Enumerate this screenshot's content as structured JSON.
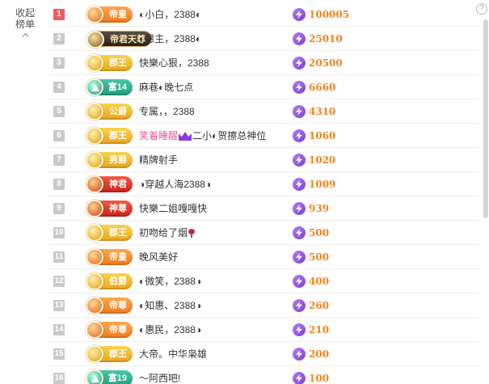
{
  "panel": {
    "collapse_label_1": "收起",
    "collapse_label_2": "榜单",
    "help_label": "?"
  },
  "rows": [
    {
      "rank": "1",
      "badge": "帝皇",
      "badge_style": "orange",
      "badge_emblem": "crown-emblem-icon",
      "name": "◐小白，2388◐",
      "score": "100005"
    },
    {
      "rank": "2",
      "badge": "帝君天尊",
      "badge_style": "dark",
      "badge_emblem": "armor-emblem-icon",
      "name": "◐惠主，2388◐",
      "score": "25010"
    },
    {
      "rank": "3",
      "badge": "郡王",
      "badge_style": "gold",
      "badge_emblem": "gold-emblem-icon",
      "name": "快樂心狠，2388",
      "score": "20500"
    },
    {
      "rank": "4",
      "badge": "富14",
      "badge_style": "teal",
      "badge_emblem": "triangle-emblem-icon",
      "name": "麻巷◐晚七点",
      "score": "6660"
    },
    {
      "rank": "5",
      "badge": "公爵",
      "badge_style": "gold",
      "badge_emblem": "gold-emblem-icon",
      "name": "专属，，2388",
      "score": "4310"
    },
    {
      "rank": "6",
      "badge": "郡王",
      "badge_style": "gold",
      "badge_emblem": "gold-emblem-icon",
      "name": "笑着睡醒",
      "name_suffix": "二小◐贺擦总神位",
      "score": "1060"
    },
    {
      "rank": "7",
      "badge": "男爵",
      "badge_style": "gold",
      "badge_emblem": "gold-emblem-icon",
      "name": "精牌射手",
      "score": "1020"
    },
    {
      "rank": "8",
      "badge": "神君",
      "badge_style": "red",
      "badge_emblem": "red-emblem-icon",
      "name": "◑穿越人海2388◑",
      "score": "1009"
    },
    {
      "rank": "9",
      "badge": "神尊",
      "badge_style": "red",
      "badge_emblem": "red-emblem-icon",
      "name": "快樂二姐嘎嘎快",
      "score": "939"
    },
    {
      "rank": "10",
      "badge": "郡王",
      "badge_style": "gold",
      "badge_emblem": "gold-emblem-icon",
      "name": "初吻给了烟",
      "score": "500"
    },
    {
      "rank": "11",
      "badge": "帝皇",
      "badge_style": "orange",
      "badge_emblem": "crown-emblem-icon",
      "name": "晚风美好",
      "score": "500"
    },
    {
      "rank": "12",
      "badge": "伯爵",
      "badge_style": "gold",
      "badge_emblem": "gold-emblem-icon",
      "name": "◐微笑，2388◑",
      "score": "400"
    },
    {
      "rank": "13",
      "badge": "帝尊",
      "badge_style": "orange",
      "badge_emblem": "crown-emblem-icon",
      "name": "◐知惠、2388◑",
      "score": "260"
    },
    {
      "rank": "14",
      "badge": "帝尊",
      "badge_style": "orange",
      "badge_emblem": "crown-emblem-icon",
      "name": "◐惠民，2388◑",
      "score": "210"
    },
    {
      "rank": "15",
      "badge": "郡王",
      "badge_style": "gold",
      "badge_emblem": "gold-emblem-icon",
      "name": "大帝。中华枭雄",
      "score": "200"
    },
    {
      "rank": "16",
      "badge": "富19",
      "badge_style": "teal",
      "badge_emblem": "triangle-emblem-icon",
      "name": "～阿西吧!",
      "score": "100"
    }
  ],
  "colors": {
    "score": "#f3831f",
    "rank_top": "#f05a5a",
    "rank_default": "#c9c9c9",
    "bolt": "#7b3fd6",
    "pink_name": "#e35c9d"
  }
}
